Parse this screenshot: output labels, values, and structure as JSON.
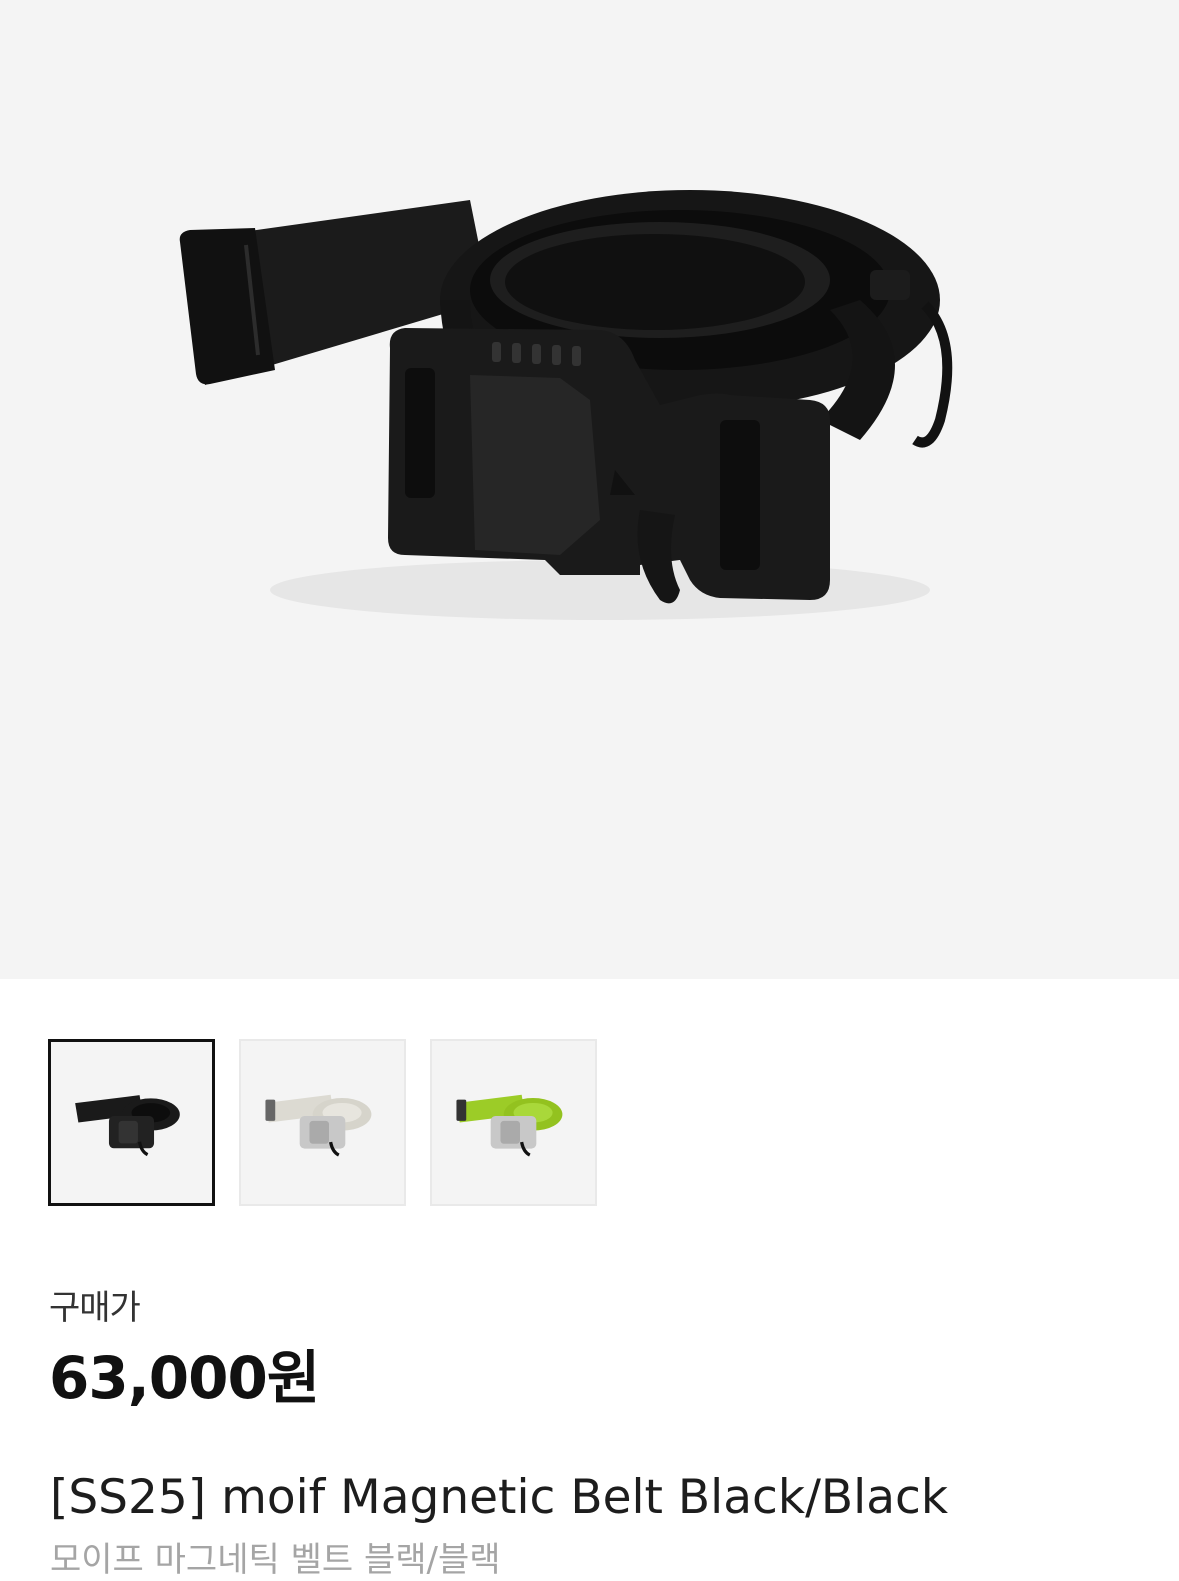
{
  "product": {
    "main_image": "magnetic-belt-black-photo",
    "thumbnails": [
      {
        "name": "belt-black-thumbnail",
        "color": "#1a1a1a",
        "selected": true
      },
      {
        "name": "belt-ivory-thumbnail",
        "color": "#dcdad2",
        "selected": false
      },
      {
        "name": "belt-lime-thumbnail",
        "color": "#9ccc27",
        "selected": false
      }
    ],
    "price_label": "구매가",
    "price": "63,000원",
    "title": "[SS25] moif Magnetic Belt Black/Black",
    "subtitle": "모이프 마그네틱 벨트 블랙/블랙"
  },
  "colors": {
    "image_background": "#f4f4f4",
    "selected_border": "#111111",
    "subtitle_text": "#a5a5a5"
  }
}
